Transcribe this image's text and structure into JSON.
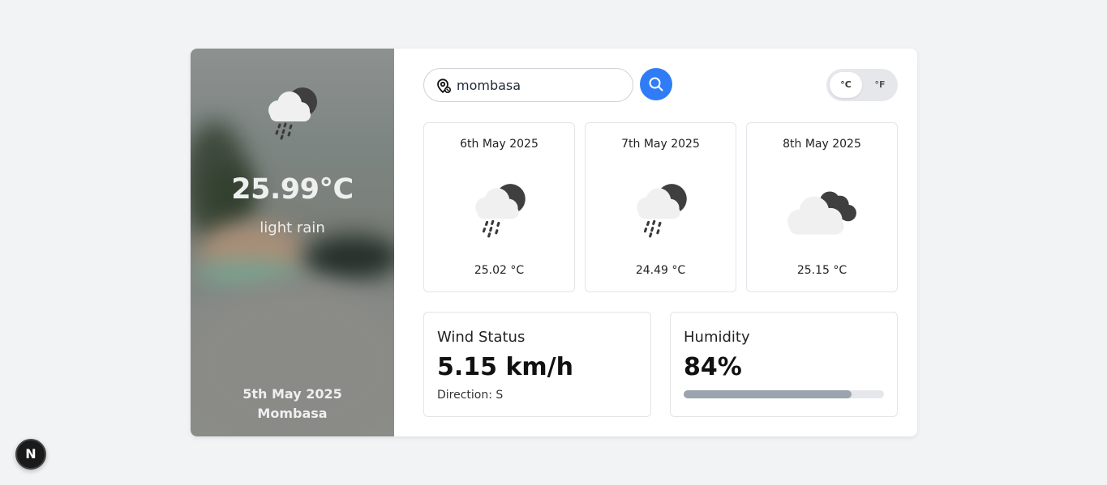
{
  "search": {
    "value": "mombasa"
  },
  "units": {
    "celsius": "°C",
    "fahrenheit": "°F"
  },
  "current": {
    "icon": "cloud-rain-night-icon",
    "temperature": "25.99°C",
    "description": "light rain",
    "date": "5th May 2025",
    "city": "Mombasa"
  },
  "forecast": [
    {
      "date": "6th May 2025",
      "icon": "cloud-rain-night-icon",
      "temp": "25.02 °C"
    },
    {
      "date": "7th May 2025",
      "icon": "cloud-rain-night-icon",
      "temp": "24.49 °C"
    },
    {
      "date": "8th May 2025",
      "icon": "clouds-icon",
      "temp": "25.15 °C"
    }
  ],
  "wind": {
    "title": "Wind Status",
    "value": "5.15 km/h",
    "direction": "Direction: S"
  },
  "humidity": {
    "title": "Humidity",
    "value": "84%",
    "percent": 84
  },
  "badge": {
    "label": "N"
  },
  "colors": {
    "accent": "#2f7cf6",
    "bar": "#9aa3ae"
  }
}
